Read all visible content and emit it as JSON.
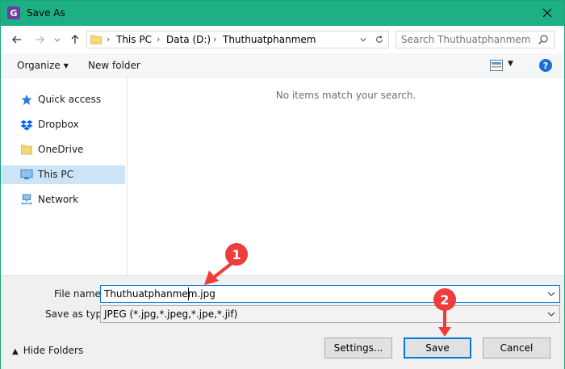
{
  "window": {
    "title": "Save As"
  },
  "address_bar": {
    "breadcrumbs": [
      "This PC",
      "Data (D:)",
      "Thuthuatphanmem"
    ]
  },
  "search": {
    "placeholder": "Search Thuthuatphanmem"
  },
  "toolbar": {
    "organize_label": "Organize",
    "new_folder_label": "New folder",
    "help_label": "?"
  },
  "nav_pane": {
    "items": [
      {
        "label": "Quick access",
        "icon": "star-icon",
        "selected": false
      },
      {
        "label": "Dropbox",
        "icon": "dropbox-icon",
        "selected": false
      },
      {
        "label": "OneDrive",
        "icon": "folder-icon",
        "selected": false
      },
      {
        "label": "This PC",
        "icon": "computer-icon",
        "selected": true
      },
      {
        "label": "Network",
        "icon": "network-icon",
        "selected": false
      }
    ]
  },
  "content": {
    "empty_message": "No items match your search."
  },
  "form": {
    "file_name_label": "File name:",
    "file_name_value": "Thuthuatphanmem.jpg",
    "save_as_type_label": "Save as type:",
    "save_as_type_value": "JPEG (*.jpg,*.jpeg,*.jpe,*.jif)"
  },
  "footer": {
    "hide_folders_label": "Hide Folders",
    "settings_label": "Settings...",
    "save_label": "Save",
    "cancel_label": "Cancel"
  },
  "annotations": {
    "step1": "1",
    "step2": "2"
  },
  "colors": {
    "titlebar": "#1db085",
    "selection": "#cce4f7",
    "accent": "#0078d7",
    "annotation": "#f03c3c"
  }
}
